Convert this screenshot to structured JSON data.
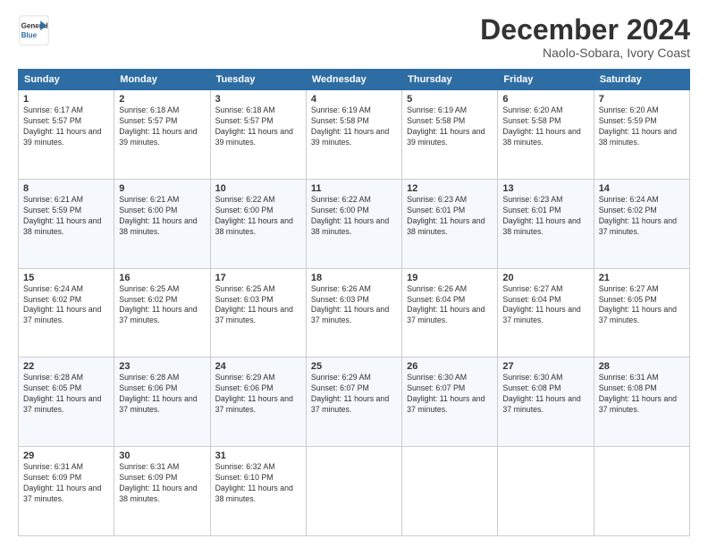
{
  "logo": {
    "line1": "General",
    "line2": "Blue"
  },
  "title": "December 2024",
  "location": "Naolo-Sobara, Ivory Coast",
  "days_of_week": [
    "Sunday",
    "Monday",
    "Tuesday",
    "Wednesday",
    "Thursday",
    "Friday",
    "Saturday"
  ],
  "weeks": [
    [
      {
        "day": "1",
        "sunrise": "6:17 AM",
        "sunset": "5:57 PM",
        "daylight": "11 hours and 39 minutes."
      },
      {
        "day": "2",
        "sunrise": "6:18 AM",
        "sunset": "5:57 PM",
        "daylight": "11 hours and 39 minutes."
      },
      {
        "day": "3",
        "sunrise": "6:18 AM",
        "sunset": "5:57 PM",
        "daylight": "11 hours and 39 minutes."
      },
      {
        "day": "4",
        "sunrise": "6:19 AM",
        "sunset": "5:58 PM",
        "daylight": "11 hours and 39 minutes."
      },
      {
        "day": "5",
        "sunrise": "6:19 AM",
        "sunset": "5:58 PM",
        "daylight": "11 hours and 39 minutes."
      },
      {
        "day": "6",
        "sunrise": "6:20 AM",
        "sunset": "5:58 PM",
        "daylight": "11 hours and 38 minutes."
      },
      {
        "day": "7",
        "sunrise": "6:20 AM",
        "sunset": "5:59 PM",
        "daylight": "11 hours and 38 minutes."
      }
    ],
    [
      {
        "day": "8",
        "sunrise": "6:21 AM",
        "sunset": "5:59 PM",
        "daylight": "11 hours and 38 minutes."
      },
      {
        "day": "9",
        "sunrise": "6:21 AM",
        "sunset": "6:00 PM",
        "daylight": "11 hours and 38 minutes."
      },
      {
        "day": "10",
        "sunrise": "6:22 AM",
        "sunset": "6:00 PM",
        "daylight": "11 hours and 38 minutes."
      },
      {
        "day": "11",
        "sunrise": "6:22 AM",
        "sunset": "6:00 PM",
        "daylight": "11 hours and 38 minutes."
      },
      {
        "day": "12",
        "sunrise": "6:23 AM",
        "sunset": "6:01 PM",
        "daylight": "11 hours and 38 minutes."
      },
      {
        "day": "13",
        "sunrise": "6:23 AM",
        "sunset": "6:01 PM",
        "daylight": "11 hours and 38 minutes."
      },
      {
        "day": "14",
        "sunrise": "6:24 AM",
        "sunset": "6:02 PM",
        "daylight": "11 hours and 37 minutes."
      }
    ],
    [
      {
        "day": "15",
        "sunrise": "6:24 AM",
        "sunset": "6:02 PM",
        "daylight": "11 hours and 37 minutes."
      },
      {
        "day": "16",
        "sunrise": "6:25 AM",
        "sunset": "6:02 PM",
        "daylight": "11 hours and 37 minutes."
      },
      {
        "day": "17",
        "sunrise": "6:25 AM",
        "sunset": "6:03 PM",
        "daylight": "11 hours and 37 minutes."
      },
      {
        "day": "18",
        "sunrise": "6:26 AM",
        "sunset": "6:03 PM",
        "daylight": "11 hours and 37 minutes."
      },
      {
        "day": "19",
        "sunrise": "6:26 AM",
        "sunset": "6:04 PM",
        "daylight": "11 hours and 37 minutes."
      },
      {
        "day": "20",
        "sunrise": "6:27 AM",
        "sunset": "6:04 PM",
        "daylight": "11 hours and 37 minutes."
      },
      {
        "day": "21",
        "sunrise": "6:27 AM",
        "sunset": "6:05 PM",
        "daylight": "11 hours and 37 minutes."
      }
    ],
    [
      {
        "day": "22",
        "sunrise": "6:28 AM",
        "sunset": "6:05 PM",
        "daylight": "11 hours and 37 minutes."
      },
      {
        "day": "23",
        "sunrise": "6:28 AM",
        "sunset": "6:06 PM",
        "daylight": "11 hours and 37 minutes."
      },
      {
        "day": "24",
        "sunrise": "6:29 AM",
        "sunset": "6:06 PM",
        "daylight": "11 hours and 37 minutes."
      },
      {
        "day": "25",
        "sunrise": "6:29 AM",
        "sunset": "6:07 PM",
        "daylight": "11 hours and 37 minutes."
      },
      {
        "day": "26",
        "sunrise": "6:30 AM",
        "sunset": "6:07 PM",
        "daylight": "11 hours and 37 minutes."
      },
      {
        "day": "27",
        "sunrise": "6:30 AM",
        "sunset": "6:08 PM",
        "daylight": "11 hours and 37 minutes."
      },
      {
        "day": "28",
        "sunrise": "6:31 AM",
        "sunset": "6:08 PM",
        "daylight": "11 hours and 37 minutes."
      }
    ],
    [
      {
        "day": "29",
        "sunrise": "6:31 AM",
        "sunset": "6:09 PM",
        "daylight": "11 hours and 37 minutes."
      },
      {
        "day": "30",
        "sunrise": "6:31 AM",
        "sunset": "6:09 PM",
        "daylight": "11 hours and 38 minutes."
      },
      {
        "day": "31",
        "sunrise": "6:32 AM",
        "sunset": "6:10 PM",
        "daylight": "11 hours and 38 minutes."
      },
      null,
      null,
      null,
      null
    ]
  ]
}
